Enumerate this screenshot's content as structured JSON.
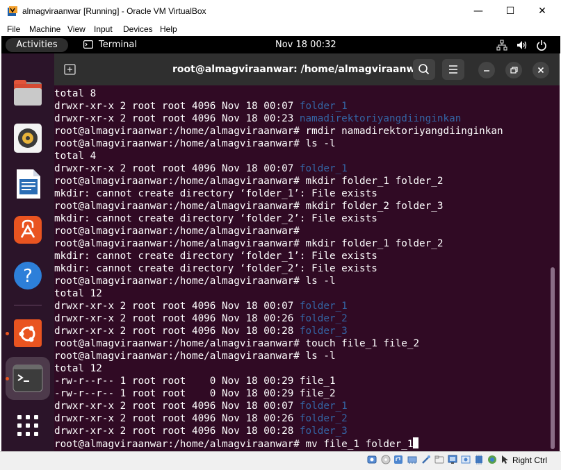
{
  "window": {
    "title": "almagviraanwar [Running] - Oracle VM VirtualBox",
    "min_symbol": "—",
    "max_symbol": "☐",
    "close_symbol": "✕"
  },
  "menubar": {
    "items": [
      "File",
      "Machine",
      "View",
      "Input",
      "Devices",
      "Help"
    ]
  },
  "topbar": {
    "activities": "Activities",
    "app_name": "Terminal",
    "clock": "Nov 18  00:32"
  },
  "dock": {
    "icons": [
      "files-icon",
      "rhythmbox-icon",
      "libreoffice-writer-icon",
      "app-center-icon",
      "help-icon",
      "ubuntu-icon",
      "terminal-icon",
      "show-apps-icon"
    ]
  },
  "terminal": {
    "title": "root@almagviraanwar: /home/almagviraanwar",
    "lines": [
      {
        "text": "total 8",
        "dir": ""
      },
      {
        "text": "drwxr-xr-x 2 root root 4096 Nov 18 00:07 ",
        "dir": "folder_1"
      },
      {
        "text": "drwxr-xr-x 2 root root 4096 Nov 18 00:23 ",
        "dir": "namadirektoriyangdiinginkan"
      },
      {
        "text": "root@almagviraanwar:/home/almagviraanwar# rmdir namadirektoriyangdiinginkan",
        "dir": ""
      },
      {
        "text": "root@almagviraanwar:/home/almagviraanwar# ls -l",
        "dir": ""
      },
      {
        "text": "total 4",
        "dir": ""
      },
      {
        "text": "drwxr-xr-x 2 root root 4096 Nov 18 00:07 ",
        "dir": "folder_1"
      },
      {
        "text": "root@almagviraanwar:/home/almagviraanwar# mkdir folder_1 folder_2",
        "dir": ""
      },
      {
        "text": "mkdir: cannot create directory ‘folder_1’: File exists",
        "dir": ""
      },
      {
        "text": "root@almagviraanwar:/home/almagviraanwar# mkdir folder_2 folder_3",
        "dir": ""
      },
      {
        "text": "mkdir: cannot create directory ‘folder_2’: File exists",
        "dir": ""
      },
      {
        "text": "root@almagviraanwar:/home/almagviraanwar#",
        "dir": ""
      },
      {
        "text": "root@almagviraanwar:/home/almagviraanwar# mkdir folder_1 folder_2",
        "dir": ""
      },
      {
        "text": "mkdir: cannot create directory ‘folder_1’: File exists",
        "dir": ""
      },
      {
        "text": "mkdir: cannot create directory ‘folder_2’: File exists",
        "dir": ""
      },
      {
        "text": "root@almagviraanwar:/home/almagviraanwar# ls -l",
        "dir": ""
      },
      {
        "text": "total 12",
        "dir": ""
      },
      {
        "text": "drwxr-xr-x 2 root root 4096 Nov 18 00:07 ",
        "dir": "folder_1"
      },
      {
        "text": "drwxr-xr-x 2 root root 4096 Nov 18 00:26 ",
        "dir": "folder_2"
      },
      {
        "text": "drwxr-xr-x 2 root root 4096 Nov 18 00:28 ",
        "dir": "folder_3"
      },
      {
        "text": "root@almagviraanwar:/home/almagviraanwar# touch file_1 file_2",
        "dir": ""
      },
      {
        "text": "root@almagviraanwar:/home/almagviraanwar# ls -l",
        "dir": ""
      },
      {
        "text": "total 12",
        "dir": ""
      },
      {
        "text": "-rw-r--r-- 1 root root    0 Nov 18 00:29 file_1",
        "dir": ""
      },
      {
        "text": "-rw-r--r-- 1 root root    0 Nov 18 00:29 file_2",
        "dir": ""
      },
      {
        "text": "drwxr-xr-x 2 root root 4096 Nov 18 00:07 ",
        "dir": "folder_1"
      },
      {
        "text": "drwxr-xr-x 2 root root 4096 Nov 18 00:26 ",
        "dir": "folder_2"
      },
      {
        "text": "drwxr-xr-x 2 root root 4096 Nov 18 00:28 ",
        "dir": "folder_3"
      }
    ],
    "prompt_line": "root@almagviraanwar:/home/almagviraanwar# mv file_1 folder_1",
    "colors": {
      "background": "#300a24",
      "text": "#ffffff",
      "directory": "#3465a4"
    }
  },
  "statusbar": {
    "host_key": "Right Ctrl"
  }
}
